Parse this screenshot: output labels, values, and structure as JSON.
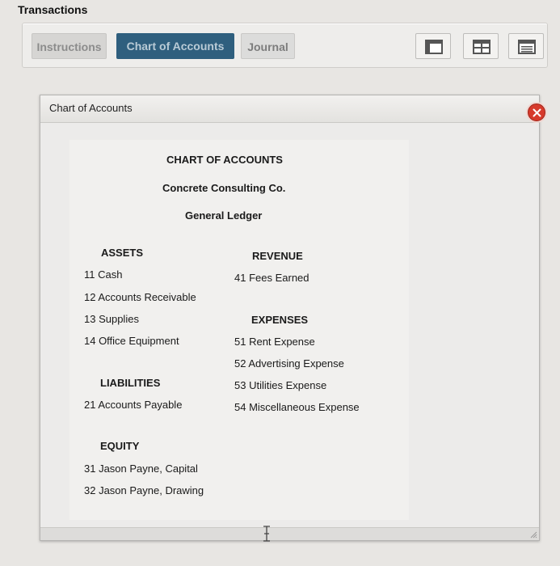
{
  "page_title": "Transactions",
  "tabs": {
    "instructions": "Instructions",
    "chart_of_accounts": "Chart of Accounts",
    "journal": "Journal"
  },
  "view_buttons": [
    "layout-single-icon",
    "layout-split-icon",
    "layout-list-icon"
  ],
  "dialog": {
    "title": "Chart of Accounts",
    "close_icon": "close-icon"
  },
  "chart": {
    "heading": "CHART OF ACCOUNTS",
    "company": "Concrete Consulting Co.",
    "ledger": "General Ledger",
    "assets": {
      "heading": "ASSETS",
      "items": [
        "11 Cash",
        "12 Accounts Receivable",
        "13 Supplies",
        "14 Office Equipment"
      ]
    },
    "liabilities": {
      "heading": "LIABILITIES",
      "items": [
        "21 Accounts Payable"
      ]
    },
    "equity": {
      "heading": "EQUITY",
      "items": [
        "31 Jason Payne, Capital",
        "32 Jason Payne, Drawing"
      ]
    },
    "revenue": {
      "heading": "REVENUE",
      "items": [
        "41 Fees Earned"
      ]
    },
    "expenses": {
      "heading": "EXPENSES",
      "items": [
        "51 Rent Expense",
        "52 Advertising Expense",
        "53 Utilities Expense",
        "54 Miscellaneous Expense"
      ]
    }
  },
  "colors": {
    "active_tab": "#2f5f7e",
    "close_button": "#d63a2c"
  }
}
